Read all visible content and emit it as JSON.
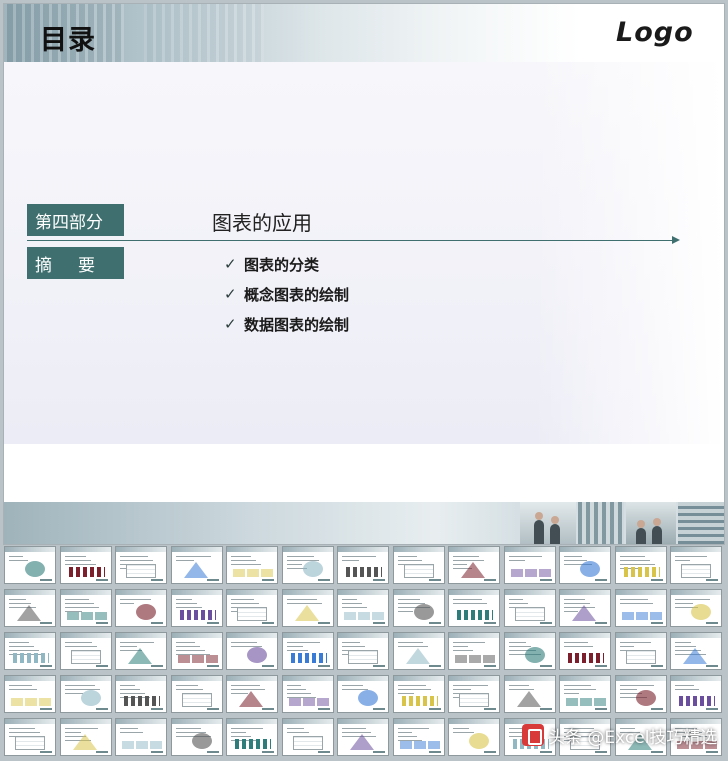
{
  "slide": {
    "title": "目录",
    "logo_text": "Logo",
    "part_tag": "第四部分",
    "summary_tag": "摘要",
    "section_heading": "图表的应用",
    "bullets": [
      "图表的分类",
      "概念图表的绘制",
      "数据图表的绘制"
    ],
    "bullet_icon": "check-icon"
  },
  "thumbnails": {
    "count": 65,
    "columns": 13
  },
  "watermark": {
    "text": "头条 @Excel技巧精选",
    "icon": "toutiao-icon"
  },
  "colors": {
    "accent": "#3f6f6f",
    "header_start": "#8aa3ad",
    "thumb_border": "#8e999e"
  }
}
